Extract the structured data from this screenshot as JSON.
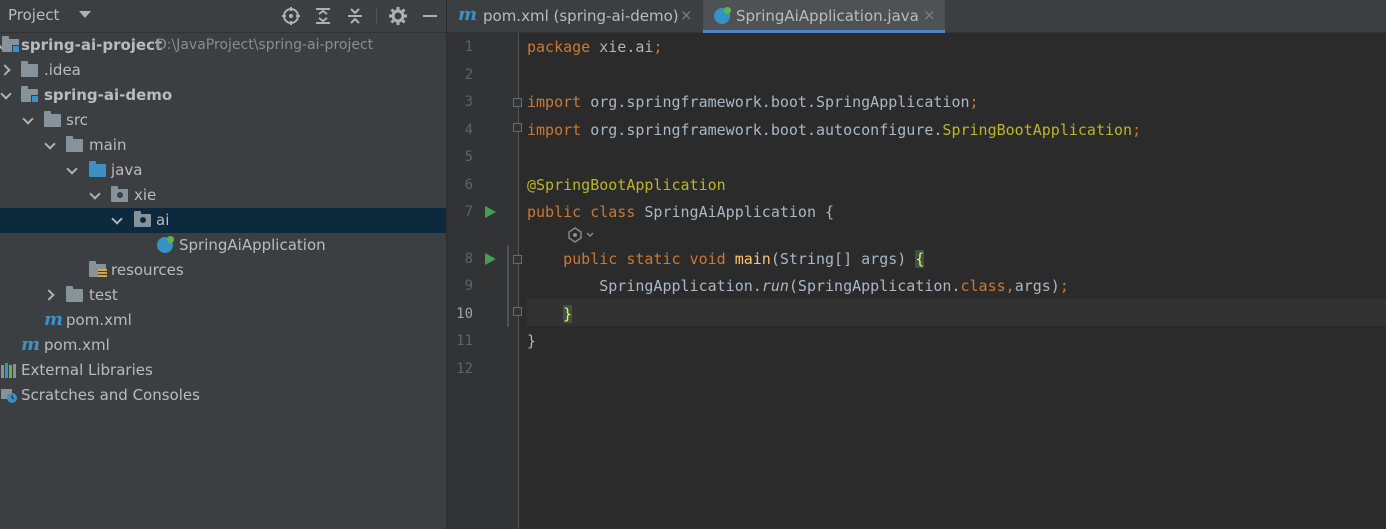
{
  "colors": {
    "panel_bg": "#3c3f41",
    "editor_bg": "#2b2b2b",
    "selection": "#0d293e",
    "keyword": "#cc7832",
    "annotation": "#bbb529",
    "method": "#ffc66d",
    "text": "#a9b7c6",
    "run_icon": "#499c54"
  },
  "project": {
    "title": "Project",
    "header_icons": [
      "locate-icon",
      "expand-all-icon",
      "collapse-all-icon",
      "gear-icon",
      "minimize-icon"
    ],
    "tree": [
      {
        "label": "spring-ai-project",
        "path": "D:\\JavaProject\\spring-ai-project",
        "icon": "module-folder-icon"
      },
      {
        "label": ".idea",
        "icon": "folder-icon"
      },
      {
        "label": "spring-ai-demo",
        "icon": "module-folder-icon"
      },
      {
        "label": "src",
        "icon": "folder-icon"
      },
      {
        "label": "main",
        "icon": "folder-icon"
      },
      {
        "label": "java",
        "icon": "source-folder-icon"
      },
      {
        "label": "xie",
        "icon": "package-icon"
      },
      {
        "label": "ai",
        "icon": "package-icon"
      },
      {
        "label": "SpringAiApplication",
        "icon": "spring-class-icon"
      },
      {
        "label": "resources",
        "icon": "resources-folder-icon"
      },
      {
        "label": "test",
        "icon": "folder-icon"
      },
      {
        "label": "pom.xml",
        "icon": "maven-icon"
      },
      {
        "label": "pom.xml",
        "icon": "maven-icon"
      },
      {
        "label": "External Libraries",
        "icon": "libraries-icon"
      },
      {
        "label": "Scratches and Consoles",
        "icon": "scratches-icon"
      }
    ]
  },
  "tabs": [
    {
      "label": "pom.xml (spring-ai-demo)",
      "icon": "maven-icon",
      "close": "×"
    },
    {
      "label": "SpringAiApplication.java",
      "icon": "spring-class-icon",
      "close": "×"
    }
  ],
  "editor": {
    "line_numbers": [
      "1",
      "2",
      "3",
      "4",
      "5",
      "6",
      "7",
      "8",
      "9",
      "10",
      "11",
      "12"
    ],
    "code": {
      "l1_kw": "package",
      "l1_rest": " xie.ai",
      "l1_semi": ";",
      "l3_kw": "import",
      "l3_rest": " org.springframework.boot.SpringApplication",
      "l3_semi": ";",
      "l4_kw": "import",
      "l4_pkg": " org.springframework.boot.autoconfigure.",
      "l4_cls": "SpringBootApplication",
      "l4_semi": ";",
      "l6_ann": "@SpringBootApplication",
      "l7_kw": "public class",
      "l7_rest": " SpringAiApplication {",
      "l8_kw": "public static void",
      "l8_fn": "main",
      "l8_rest": "(String[] args) ",
      "l8_brace": "{",
      "l9_a": "SpringApplication.",
      "l9_run": "run",
      "l9_b": "(SpringApplication.",
      "l9_cls": "class",
      "l9_comma": ",",
      "l9_c": "args)",
      "l9_semi": ";",
      "l10_brace": "}",
      "l11": "}"
    }
  }
}
